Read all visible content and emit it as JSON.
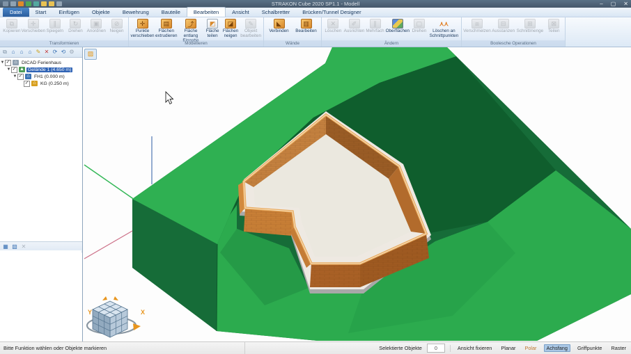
{
  "window": {
    "title": "STRAKON Cube 2020 SP1.1 - Modell",
    "minimize": "–",
    "maximize": "▢",
    "close": "✕"
  },
  "menu": {
    "tabs": [
      {
        "label": "Datei"
      },
      {
        "label": "Start"
      },
      {
        "label": "Einfügen"
      },
      {
        "label": "Objekte"
      },
      {
        "label": "Bewehrung"
      },
      {
        "label": "Bauteile"
      },
      {
        "label": "Bearbeiten",
        "active": true
      },
      {
        "label": "Ansicht"
      },
      {
        "label": "Schalbretter"
      },
      {
        "label": "Brücken/Tunnel Designer"
      }
    ]
  },
  "ribbon": {
    "groups": [
      {
        "title": "Transformieren",
        "buttons": [
          {
            "label": "Kopieren",
            "enabled": false
          },
          {
            "label": "Verschieben",
            "enabled": false
          },
          {
            "label": "Spiegeln",
            "enabled": false
          },
          {
            "label": "Drehen",
            "enabled": false
          },
          {
            "label": "Anordnen",
            "enabled": false
          },
          {
            "label": "Neigen",
            "enabled": false
          }
        ]
      },
      {
        "title": "Modellieren",
        "buttons": [
          {
            "label": "Punkte verschieben",
            "enabled": true
          },
          {
            "label": "Flächen extrudieren",
            "enabled": true
          },
          {
            "label": "Fläche entlang Eingabe",
            "enabled": true
          },
          {
            "label": "Fläche teilen",
            "enabled": true
          },
          {
            "label": "Flächen neigen",
            "enabled": true
          },
          {
            "label": "Objekt bearbeiten",
            "enabled": false
          }
        ]
      },
      {
        "title": "Wände",
        "buttons": [
          {
            "label": "Verbinden",
            "enabled": true
          },
          {
            "label": "Bearbeiten",
            "enabled": true
          }
        ]
      },
      {
        "title": "Ändern",
        "buttons": [
          {
            "label": "Löschen",
            "enabled": false
          },
          {
            "label": "Ausrichten",
            "enabled": false
          },
          {
            "label": "Mehrfach",
            "enabled": false
          },
          {
            "label": "Oberflächen",
            "enabled": true
          },
          {
            "label": "Drehen",
            "enabled": false
          },
          {
            "label": "Löschen an Schnittpunkten",
            "enabled": true
          }
        ]
      },
      {
        "title": "Boolesche Operationen",
        "buttons": [
          {
            "label": "Verschmelzen",
            "enabled": false
          },
          {
            "label": "Ausstanzen",
            "enabled": false
          },
          {
            "label": "Schnittmenge",
            "enabled": false
          },
          {
            "label": "Teilen",
            "enabled": false
          }
        ]
      }
    ]
  },
  "tree": {
    "items": [
      {
        "label": "DICAD Ferienhaus"
      },
      {
        "label": "Gelände 1 (4.650 m)",
        "selected": true
      },
      {
        "label": "FH1 (0.000 m)"
      },
      {
        "label": "KG (0.250 m)"
      }
    ]
  },
  "viewport": {
    "axis_x_label": "X",
    "axis_y_label": "Y"
  },
  "status": {
    "message": "Bitte Funktion wählen oder Objekte markieren",
    "selected_label": "Selektierte Objekte",
    "selected_count": "0",
    "toggles": [
      {
        "label": "Ansicht fixieren"
      },
      {
        "label": "Planar"
      },
      {
        "label": "Polar"
      },
      {
        "label": "Achsfang",
        "active": true
      },
      {
        "label": "Griffpunkte"
      },
      {
        "label": "Raster"
      }
    ]
  },
  "colors": {
    "titlebar": "#4e6375",
    "selection_blue": "#2f63b5",
    "active_highlight": "#abc8e6",
    "terrain_top": "#2fb052",
    "terrain_dark": "#166c38",
    "pit_shadow": "#0f5e2d",
    "slope_lit": "#2cab4e",
    "facet_a": "#259a47",
    "facet_b": "#27a34a",
    "brick_lit": "#c4813f",
    "brick_dark": "#9a5c25",
    "wall_rim": "#e9a95c",
    "foundation": "#eee9e2",
    "floor": "#ebe8df",
    "axis_x": "#cc7088",
    "axis_y": "#35b858",
    "axis_z": "#7090c0",
    "polar_orange": "#c07830"
  }
}
